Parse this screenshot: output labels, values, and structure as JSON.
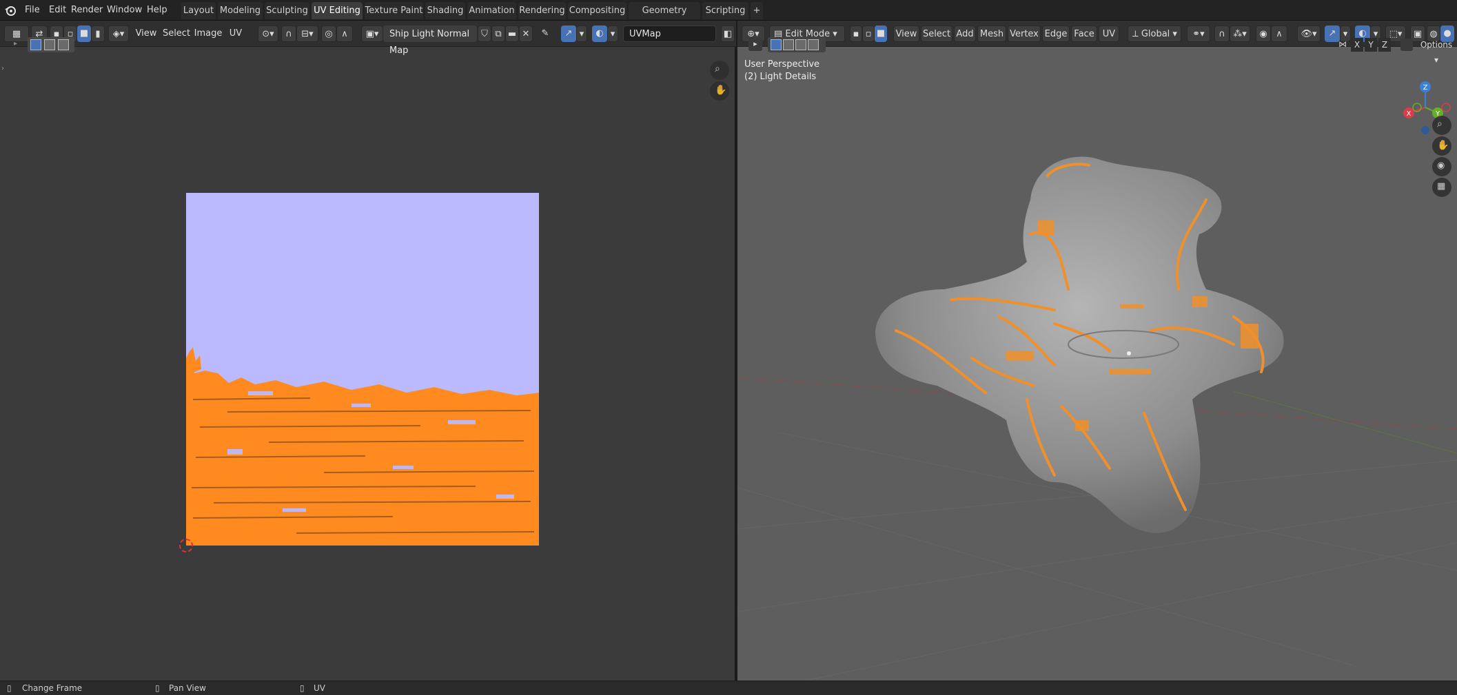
{
  "topbar": {
    "menus": [
      "File",
      "Edit",
      "Render",
      "Window",
      "Help"
    ],
    "workspaces": [
      {
        "label": "Layout",
        "active": false
      },
      {
        "label": "Modeling",
        "active": false
      },
      {
        "label": "Sculpting",
        "active": false
      },
      {
        "label": "UV Editing",
        "active": true
      },
      {
        "label": "Texture Paint",
        "active": false
      },
      {
        "label": "Shading",
        "active": false
      },
      {
        "label": "Animation",
        "active": false
      },
      {
        "label": "Rendering",
        "active": false
      },
      {
        "label": "Compositing",
        "active": false
      },
      {
        "label": "Geometry Nodes",
        "active": false
      },
      {
        "label": "Scripting",
        "active": false
      }
    ],
    "add_workspace": "+"
  },
  "uv_editor": {
    "menus": [
      "View",
      "Select",
      "Image",
      "UV"
    ],
    "image_name": "Ship Light Normal Map",
    "uv_map": "UVMap",
    "colors": {
      "background": "#3b3b3b",
      "image": "#bcbaff",
      "uv_islands": "#ff8a1f"
    }
  },
  "viewport": {
    "mode": "Edit Mode",
    "menus": [
      "View",
      "Select",
      "Add",
      "Mesh",
      "Vertex",
      "Edge",
      "Face",
      "UV"
    ],
    "transform_orientation": "Global",
    "options_label": "Options",
    "axes_buttons": [
      "X",
      "Y",
      "Z"
    ],
    "overlay_line1": "User Perspective",
    "overlay_line2": "(2) Light Details",
    "gizmo": {
      "z": "Z",
      "x": "X",
      "y": "Y"
    },
    "colors": {
      "background": "#5e5e5e",
      "mesh": "#9a9a9a",
      "selection": "#f0902a"
    }
  },
  "statusbar": {
    "items": [
      {
        "icon": "mouse-left-icon",
        "label": "Change Frame"
      },
      {
        "icon": "mouse-middle-icon",
        "label": "Pan View"
      },
      {
        "icon": "mouse-right-icon",
        "label": "UV"
      }
    ]
  }
}
